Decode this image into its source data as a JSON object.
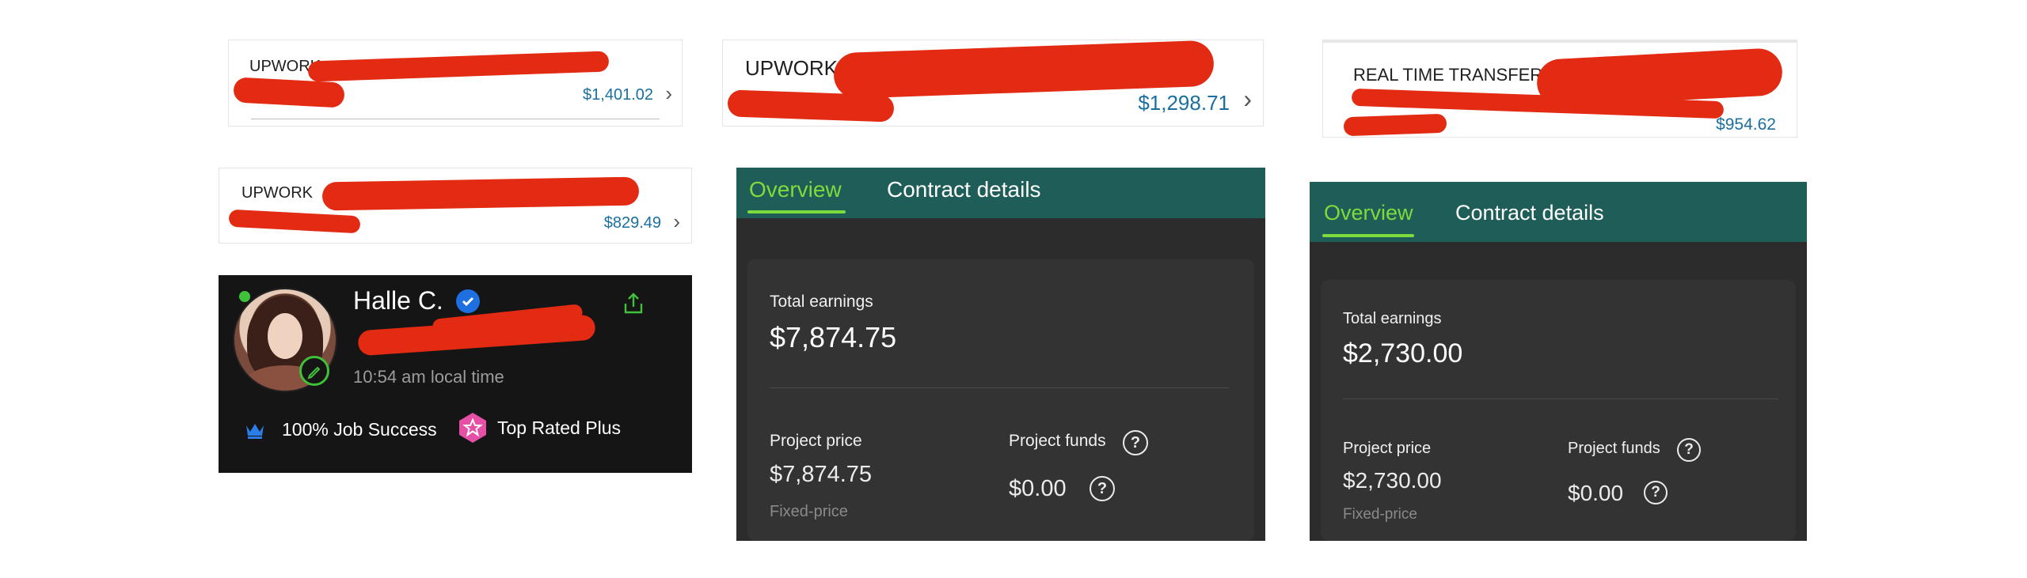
{
  "transactions": [
    {
      "label": "UPWORK",
      "amount": "$1,401.02",
      "chevron": "›"
    },
    {
      "label": "UPWORK",
      "amount": "$1,298.71",
      "chevron": "›"
    },
    {
      "label": "REAL TIME TRANSFER",
      "amount": "$954.62"
    },
    {
      "label": "UPWORK",
      "amount": "$829.49",
      "chevron": "›"
    }
  ],
  "profile": {
    "name": "Halle C.",
    "local_time": "10:54 am local time",
    "job_success": "100% Job Success",
    "badge": "Top Rated Plus",
    "icons": [
      "verified-icon",
      "share-icon",
      "edit-icon",
      "crown-icon",
      "top-rated-plus-icon"
    ],
    "colors": {
      "online": "#3fc13a",
      "verified": "#1e6fe0",
      "badge": "#e64fa6"
    }
  },
  "contracts": [
    {
      "tabs": [
        "Overview",
        "Contract details"
      ],
      "total_earnings_label": "Total earnings",
      "total_earnings": "$7,874.75",
      "project_price_label": "Project price",
      "project_price": "$7,874.75",
      "price_type": "Fixed-price",
      "project_funds_label": "Project funds",
      "project_funds": "$0.00"
    },
    {
      "tabs": [
        "Overview",
        "Contract details"
      ],
      "total_earnings_label": "Total earnings",
      "total_earnings": "$2,730.00",
      "project_price_label": "Project price",
      "project_price": "$2,730.00",
      "price_type": "Fixed-price",
      "project_funds_label": "Project funds",
      "project_funds": "$0.00"
    }
  ],
  "theme": {
    "tab_bar": "#1f5e58",
    "tab_active": "#7ddb3c",
    "amount_blue": "#1a6f9f",
    "redaction": "#e32a12"
  }
}
